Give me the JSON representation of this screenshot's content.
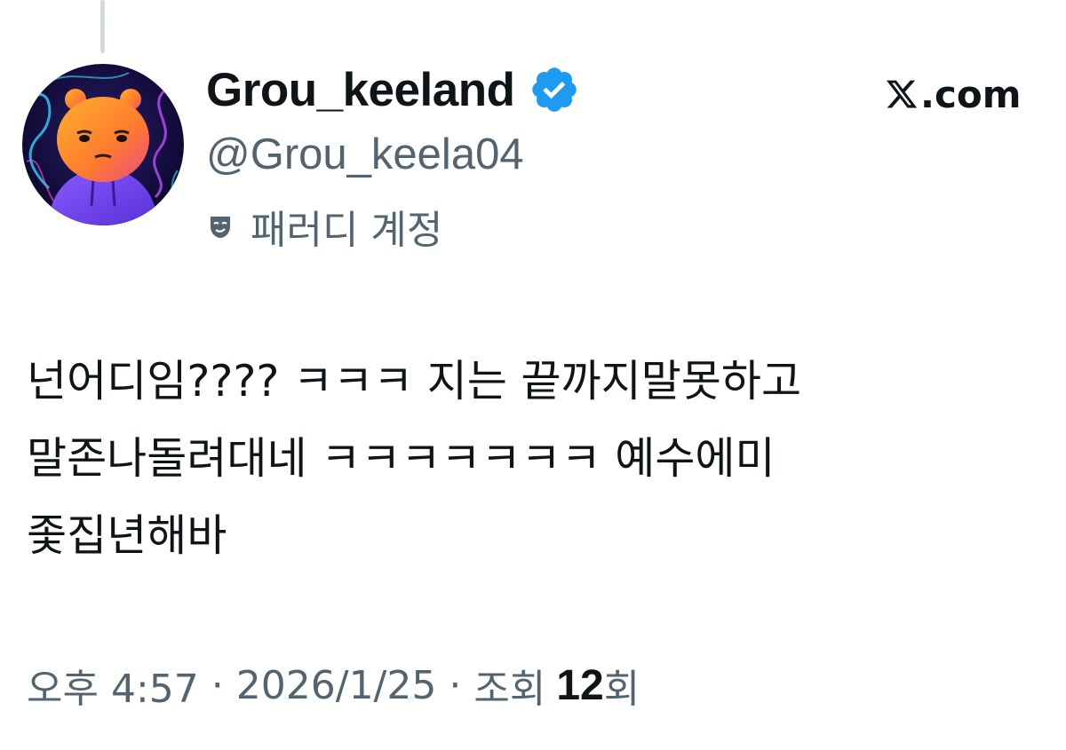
{
  "author": {
    "display_name": "Grou_keeland",
    "handle": "@Grou_keela04",
    "label": "패러디 계정",
    "verified": true,
    "avatar_icon": "orange-bear-hoodie-avatar",
    "badge_color": "#1d9bf0"
  },
  "brand": {
    "logo_text": ".com",
    "logo_icon": "x-logo-icon"
  },
  "tweet": {
    "lines": [
      "넌어디임???? ㅋㅋㅋ 지는 끝까지말못하고",
      "말존나돌려대네 ㅋㅋㅋㅋㅋㅋㅋ 예수에미",
      "좇집년해바"
    ]
  },
  "meta": {
    "time": "오후 4:57",
    "separator": "·",
    "date": "2026/1/25",
    "views_prefix": "조회",
    "views_count": "12",
    "views_suffix": "회"
  },
  "colors": {
    "text_primary": "#0f1419",
    "text_secondary": "#536471",
    "thread_line": "#cfd9de"
  }
}
